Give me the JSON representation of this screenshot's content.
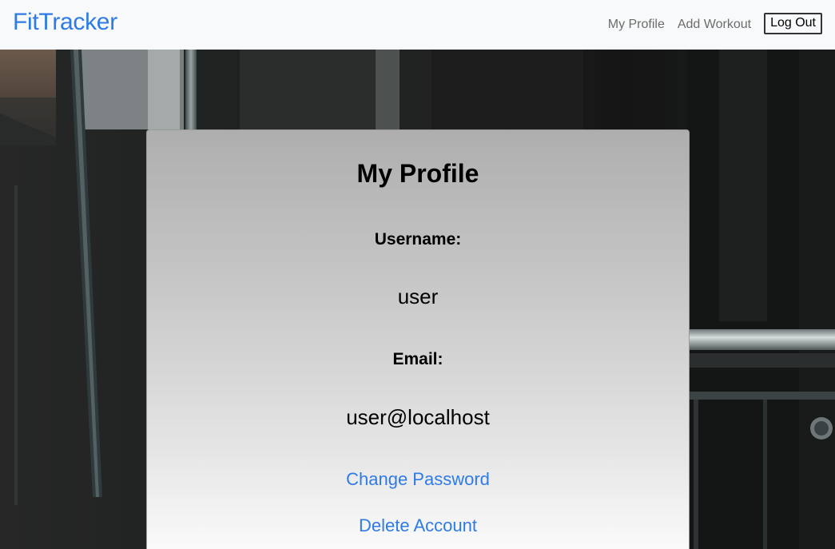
{
  "navbar": {
    "brand": "FitTracker",
    "links": [
      "My Profile",
      "Add Workout"
    ],
    "logout_label": "Log Out"
  },
  "profile": {
    "title": "My Profile",
    "username_label": "Username:",
    "username_value": "user",
    "email_label": "Email:",
    "email_value": "user@localhost",
    "change_password_label": "Change Password",
    "delete_account_label": "Delete Account"
  },
  "colors": {
    "brand": "#2f7be6",
    "link": "#2f7be6",
    "navbar_bg": "#f8f9fa"
  }
}
